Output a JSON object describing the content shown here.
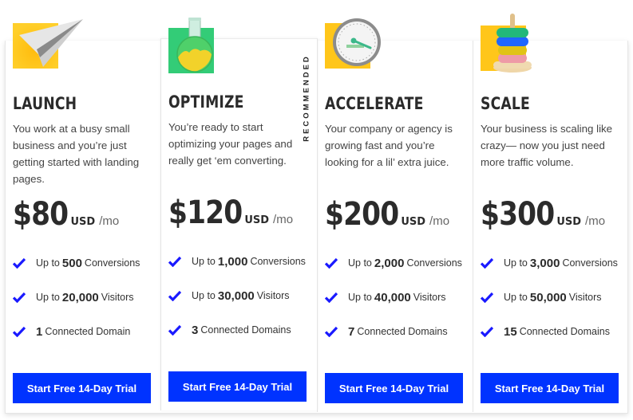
{
  "accent_color": "#0033ff",
  "plans": [
    {
      "name": "LAUNCH",
      "icon": "paper-plane-icon",
      "description": "You work at a busy small business and you’re just getting started with landing pages.",
      "price": "$80",
      "currency": "USD",
      "period": "/mo",
      "features": [
        {
          "prefix": "Up to",
          "value": "500",
          "suffix": "Conversions"
        },
        {
          "prefix": "Up to",
          "value": "20,000",
          "suffix": "Visitors"
        },
        {
          "prefix": "",
          "value": "1",
          "suffix": "Connected Domain"
        }
      ],
      "cta": "Start Free 14-Day Trial"
    },
    {
      "name": "OPTIMIZE",
      "icon": "flask-icon",
      "badge": "RECOMMENDED",
      "description": "You’re ready to start optimizing your pages and really get ‘em converting.",
      "price": "$120",
      "currency": "USD",
      "period": "/mo",
      "features": [
        {
          "prefix": "Up to",
          "value": "1,000",
          "suffix": "Conversions"
        },
        {
          "prefix": "Up to",
          "value": "30,000",
          "suffix": "Visitors"
        },
        {
          "prefix": "",
          "value": "3",
          "suffix": "Connected Domains"
        }
      ],
      "cta": "Start Free 14-Day Trial"
    },
    {
      "name": "ACCELERATE",
      "icon": "speedometer-icon",
      "description": "Your company or agency is growing fast and you’re looking for a lil’ extra juice.",
      "price": "$200",
      "currency": "USD",
      "period": "/mo",
      "features": [
        {
          "prefix": "Up to",
          "value": "2,000",
          "suffix": "Conversions"
        },
        {
          "prefix": "Up to",
          "value": "40,000",
          "suffix": "Visitors"
        },
        {
          "prefix": "",
          "value": "7",
          "suffix": "Connected Domains"
        }
      ],
      "cta": "Start Free 14-Day Trial"
    },
    {
      "name": "SCALE",
      "icon": "stacking-rings-icon",
      "description": "Your business is scaling like crazy— now you just need more traffic volume.",
      "price": "$300",
      "currency": "USD",
      "period": "/mo",
      "features": [
        {
          "prefix": "Up to",
          "value": "3,000",
          "suffix": "Conversions"
        },
        {
          "prefix": "Up to",
          "value": "50,000",
          "suffix": "Visitors"
        },
        {
          "prefix": "",
          "value": "15",
          "suffix": "Connected Domains"
        }
      ],
      "cta": "Start Free 14-Day Trial"
    }
  ]
}
